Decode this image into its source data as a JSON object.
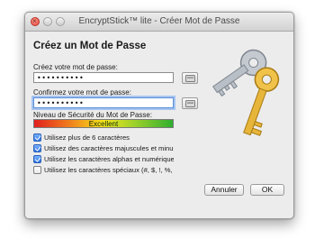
{
  "window": {
    "title": "EncryptStick™ lite - Créer Mot de Passe"
  },
  "dialog": {
    "heading": "Créez un Mot de Passe",
    "password_label": "Créez votre mot de passe:",
    "password_value": "••••••••••",
    "confirm_label": "Confirmez votre mot de passe:",
    "confirm_value": "••••••••••",
    "security_label": "Niveau de Sécurité du Mot de Passe:",
    "security_text": "Excellent",
    "security_level": 1.0
  },
  "checks": [
    {
      "label": "Utilisez plus de 6 caractères",
      "checked": true
    },
    {
      "label": "Utilisez des caractères majuscules et minuscule",
      "checked": true
    },
    {
      "label": "Utilisez les caractères alphas et numériques",
      "checked": true
    },
    {
      "label": "Utilisez les caractères spéciaux (#, $, !, %, &, ^,",
      "checked": false
    }
  ],
  "buttons": {
    "cancel": "Annuler",
    "ok": "OK"
  },
  "colors": {
    "focus_ring": "#a6c4f0",
    "meter_low": "#e01f1f",
    "meter_high": "#2fae2f",
    "key_gold": "#e6b53a",
    "key_silver": "#b9bfc7"
  },
  "icons": [
    "close-icon",
    "minimize-icon",
    "zoom-icon",
    "key-icon",
    "key-icon",
    "keys-illustration"
  ]
}
